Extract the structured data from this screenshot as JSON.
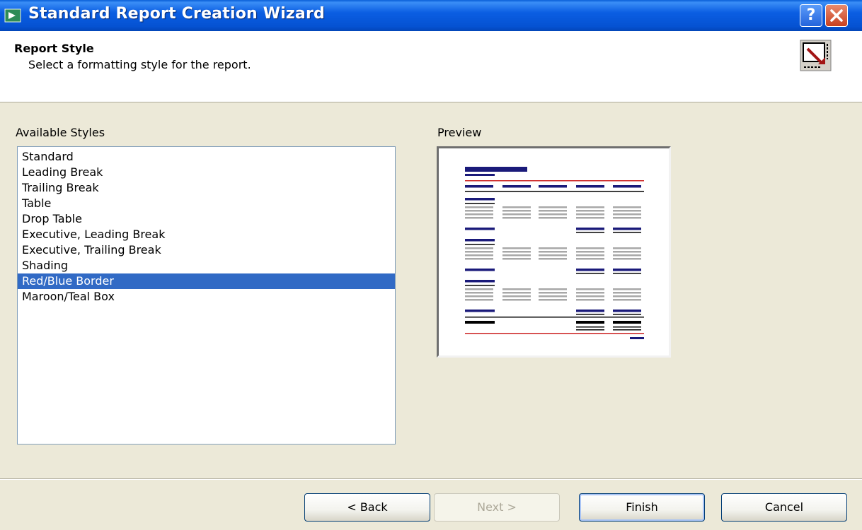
{
  "window": {
    "title": "Standard Report Creation Wizard",
    "help_label": "?"
  },
  "header": {
    "title": "Report Style",
    "subtitle": "Select a formatting style for the report."
  },
  "styles": {
    "label": "Available Styles",
    "items": [
      "Standard",
      "Leading Break",
      "Trailing Break",
      "Table",
      "Drop Table",
      "Executive, Leading Break",
      "Executive, Trailing Break",
      "Shading",
      "Red/Blue Border",
      "Maroon/Teal Box"
    ],
    "selected": "Red/Blue Border"
  },
  "preview": {
    "label": "Preview"
  },
  "buttons": {
    "back": "< Back",
    "next": "Next >",
    "finish": "Finish",
    "cancel": "Cancel"
  },
  "colors": {
    "accent": "#316ac5",
    "navy": "#1a1a7a",
    "red": "#cc2222",
    "gray": "#a8a8a8",
    "titlebar": "#0a58d8"
  }
}
